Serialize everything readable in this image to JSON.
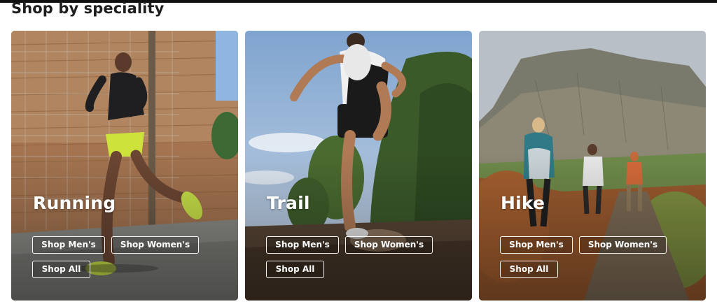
{
  "section": {
    "title": "Shop by speciality"
  },
  "cards": [
    {
      "title": "Running",
      "image_alt": "woman running past a wooden wall",
      "buttons": {
        "men": "Shop Men's",
        "women": "Shop Women's",
        "all": "Shop All"
      }
    },
    {
      "title": "Trail",
      "image_alt": "man running on a trail with trees",
      "buttons": {
        "men": "Shop Men's",
        "women": "Shop Women's",
        "all": "Shop All"
      }
    },
    {
      "title": "Hike",
      "image_alt": "three hikers on a mountain path",
      "buttons": {
        "men": "Shop Men's",
        "women": "Shop Women's",
        "all": "Shop All"
      }
    }
  ]
}
